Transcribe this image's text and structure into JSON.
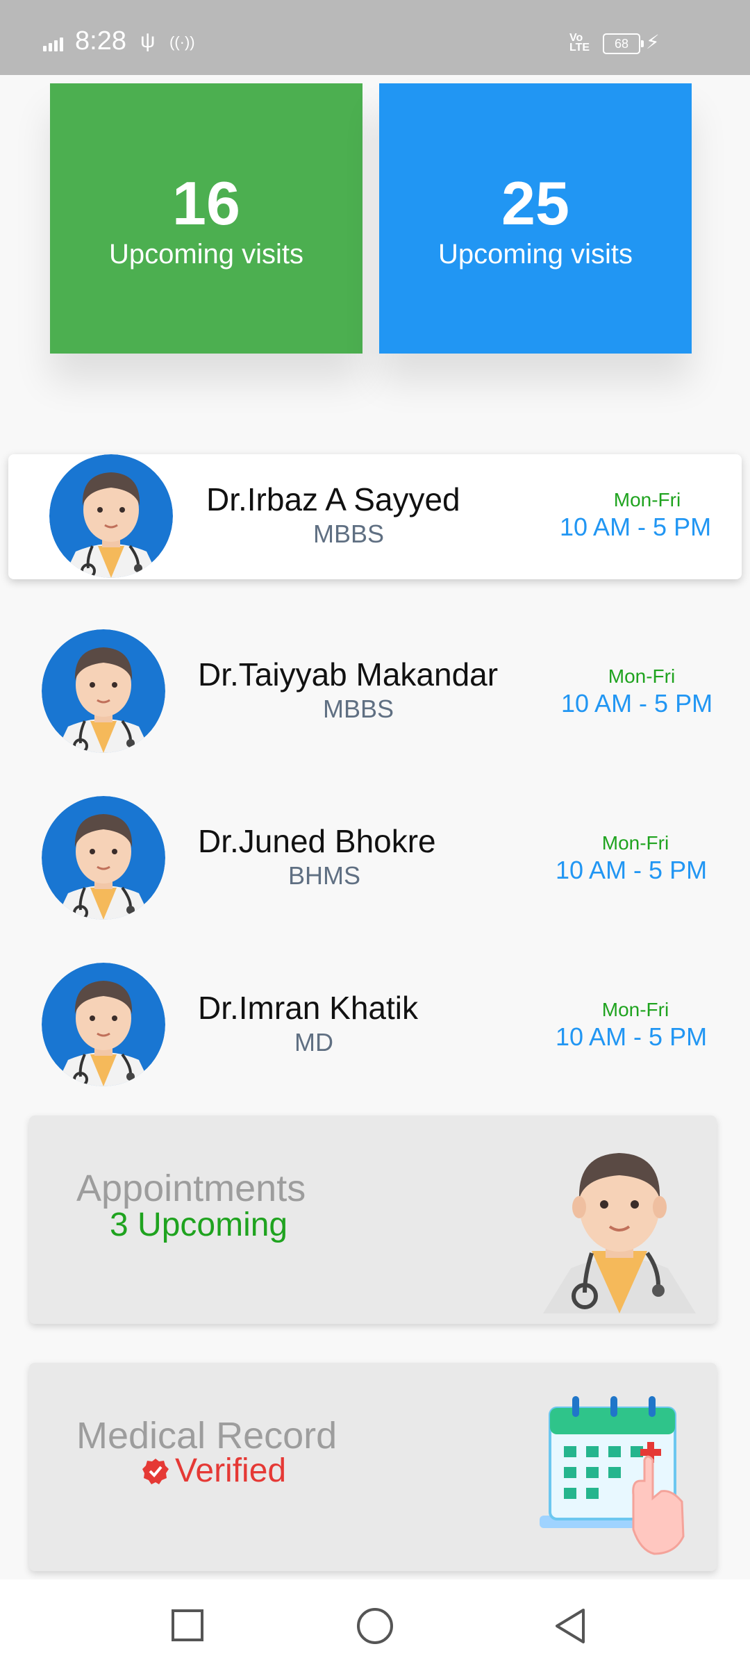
{
  "status_bar": {
    "time": "8:28",
    "battery": "68",
    "network": "Vo LTE"
  },
  "stats": [
    {
      "value": "16",
      "label": "Upcoming visits",
      "color": "#4caf50"
    },
    {
      "value": "25",
      "label": "Upcoming visits",
      "color": "#2196f3"
    }
  ],
  "doctors": [
    {
      "name": "Dr.Irbaz A Sayyed",
      "degree": "MBBS",
      "days": "Mon-Fri",
      "hours": "10 AM - 5 PM"
    },
    {
      "name": "Dr.Taiyyab Makandar",
      "degree": "MBBS",
      "days": "Mon-Fri",
      "hours": "10 AM - 5 PM"
    },
    {
      "name": "Dr.Juned Bhokre",
      "degree": "BHMS",
      "days": "Mon-Fri",
      "hours": "10 AM - 5 PM"
    },
    {
      "name": "Dr.Imran Khatik",
      "degree": "MD",
      "days": "Mon-Fri",
      "hours": "10 AM - 5 PM"
    }
  ],
  "appointments": {
    "title": "Appointments",
    "subtitle": "3 Upcoming",
    "subtitle_color": "#1fa31f"
  },
  "medical_record": {
    "title": "Medical Record",
    "status": "Verified",
    "status_color": "#e53935"
  },
  "icons": [
    "usb-icon",
    "hotspot-icon",
    "battery-icon",
    "charging-icon",
    "doctor-avatar-icon",
    "calendar-icon",
    "verified-icon",
    "recents-icon",
    "home-icon",
    "back-icon"
  ]
}
